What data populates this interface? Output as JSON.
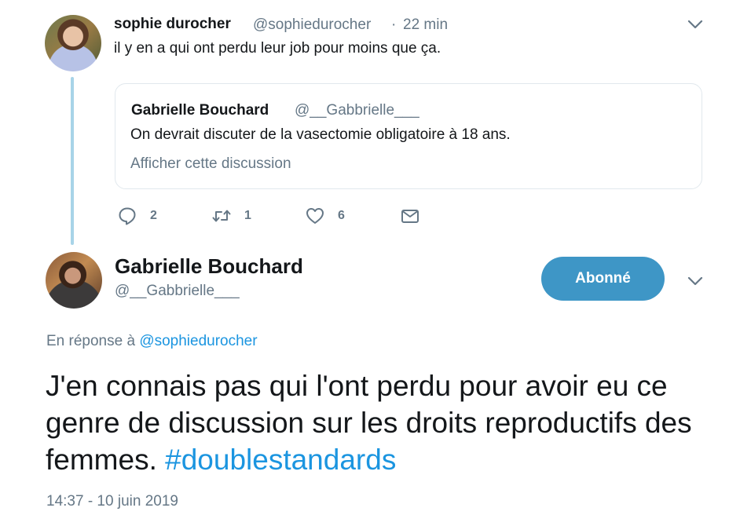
{
  "parent_tweet": {
    "author_name": "sophie durocher",
    "author_handle": "@sophiedurocher",
    "separator": "·",
    "time": "22 min",
    "text": "il y en a qui ont perdu leur job pour moins que ça.",
    "quoted": {
      "author_name": "Gabrielle Bouchard",
      "author_handle": "@__Gabbrielle___",
      "text": "On devrait discuter de la vasectomie obligatoire à 18 ans.",
      "show_thread_label": "Afficher cette discussion"
    },
    "actions": {
      "reply_count": "2",
      "retweet_count": "1",
      "like_count": "6"
    }
  },
  "main_tweet": {
    "author_name": "Gabrielle Bouchard",
    "author_handle": "@__Gabbrielle___",
    "follow_label": "Abonné",
    "reply_to_prefix": "En réponse à",
    "reply_to_handle": "@sophiedurocher",
    "text": "J'en connais pas qui l'ont perdu pour avoir eu ce genre de discussion sur les droits reproductifs des femmes.",
    "hashtag": "#doublestandards",
    "timestamp": "14:37 - 10 juin 2019"
  },
  "colors": {
    "link_blue": "#1b95e0",
    "follow_button": "#3e96c6",
    "thread_line": "#a8d4e8",
    "secondary_text": "#657786"
  },
  "icons": [
    "reply-icon",
    "retweet-icon",
    "heart-icon",
    "envelope-icon",
    "chevron-down-icon"
  ]
}
